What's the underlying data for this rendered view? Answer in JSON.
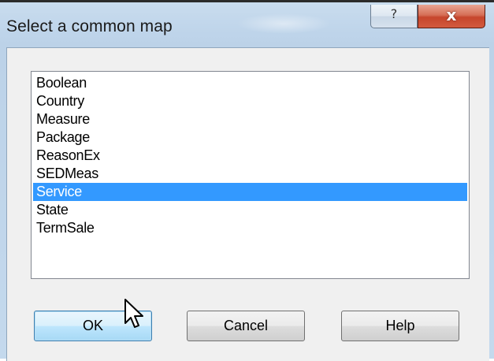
{
  "dialog": {
    "title": "Select a common map",
    "help_glyph": "?",
    "close_glyph": "x"
  },
  "list": {
    "items": [
      "Boolean",
      "Country",
      "Measure",
      "Package",
      "ReasonEx",
      "SEDMeas",
      "Service",
      "State",
      "TermSale"
    ],
    "selected": "Service"
  },
  "buttons": {
    "ok": "OK",
    "cancel": "Cancel",
    "help": "Help"
  },
  "icons": {
    "help": "question-mark-icon",
    "close": "close-icon",
    "cursor": "pointer-cursor-icon"
  },
  "colors": {
    "selection": "#3399ff",
    "close_button": "#c6452c"
  }
}
